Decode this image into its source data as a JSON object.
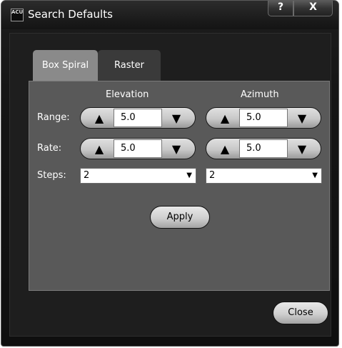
{
  "window": {
    "title": "Search Defaults",
    "app_icon_text": "ACU",
    "help_label": "?",
    "close_label": "X"
  },
  "tabs": [
    {
      "label": "Box Spiral",
      "active": true
    },
    {
      "label": "Raster",
      "active": false
    }
  ],
  "columns": {
    "elevation": "Elevation",
    "azimuth": "Azimuth"
  },
  "rows": {
    "range": {
      "label": "Range:",
      "elevation": "5.0",
      "azimuth": "5.0"
    },
    "rate": {
      "label": "Rate:",
      "elevation": "5.0",
      "azimuth": "5.0"
    },
    "steps": {
      "label": "Steps:",
      "elevation": "2",
      "azimuth": "2"
    }
  },
  "buttons": {
    "apply": "Apply",
    "close": "Close"
  },
  "icons": {
    "up": "▲",
    "down": "▼",
    "dropdown": "▼"
  }
}
